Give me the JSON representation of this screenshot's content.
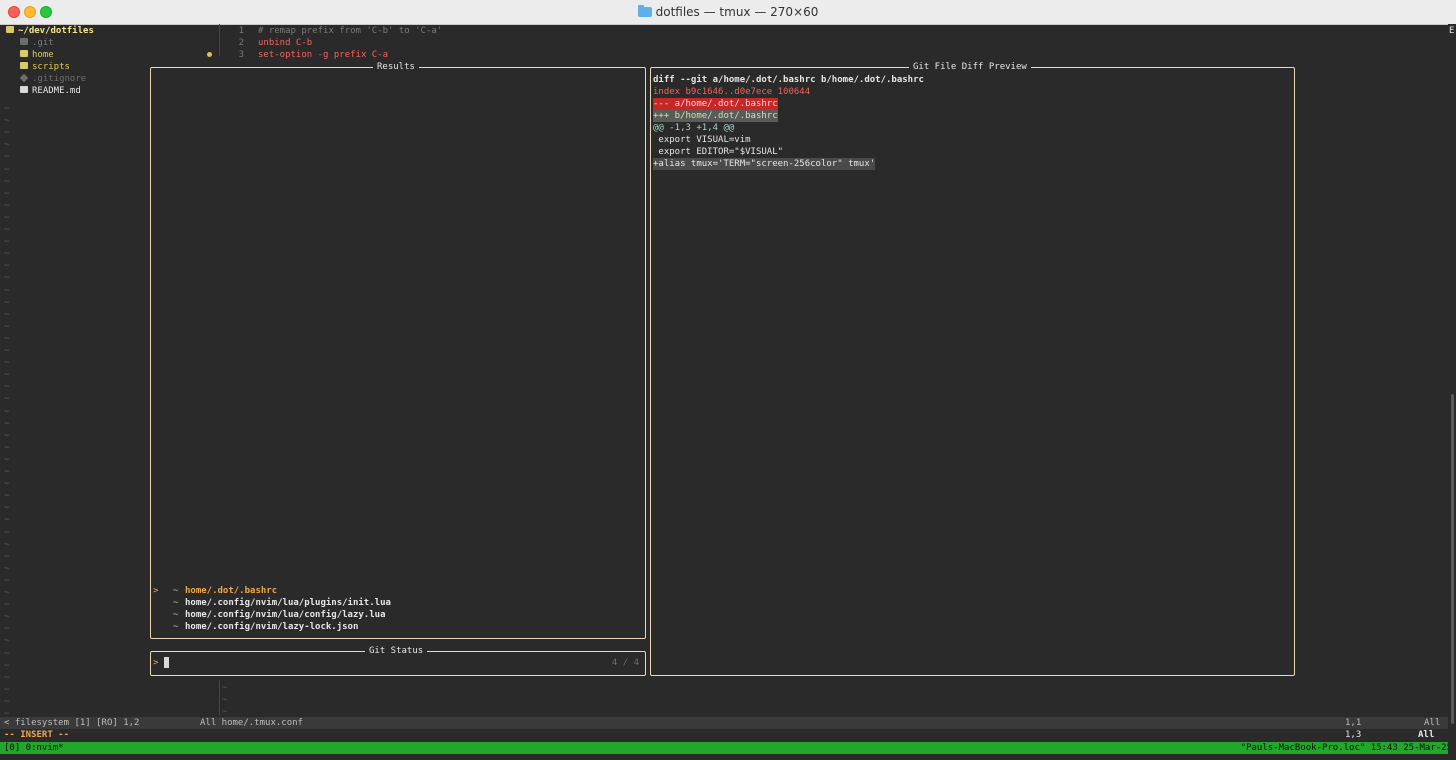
{
  "window": {
    "title": "dotfiles — tmux — 270×60"
  },
  "tree": {
    "root": "~/dev/dotfiles",
    "items": [
      {
        "name": ".git",
        "kind": "dir-dim",
        "color": "#7a7a7a"
      },
      {
        "name": "home",
        "kind": "dir",
        "color": "#d7c96c"
      },
      {
        "name": "scripts",
        "kind": "dir",
        "color": "#e3c94f"
      },
      {
        "name": ".gitignore",
        "kind": "file-dim",
        "color": "#6d6d6d"
      },
      {
        "name": "README.md",
        "kind": "md",
        "color": "#e6e6e6"
      }
    ]
  },
  "editor": {
    "lines": [
      {
        "n": "1",
        "text": "# remap prefix from 'C-b' to 'C-a'"
      },
      {
        "n": "2",
        "text": "unbind C-b"
      },
      {
        "n": "3",
        "text": "set-option -g prefix C-a"
      }
    ]
  },
  "results": {
    "title": "Results",
    "items": [
      {
        "path": "home/.dot/.bashrc",
        "status": "~",
        "selected": true
      },
      {
        "path": "home/.config/nvim/lua/plugins/init.lua",
        "status": "~",
        "selected": false
      },
      {
        "path": "home/.config/nvim/lua/config/lazy.lua",
        "status": "~",
        "selected": false
      },
      {
        "path": "home/.config/nvim/lazy-lock.json",
        "status": "~",
        "selected": false
      }
    ],
    "prompt_marker": ">"
  },
  "git_status": {
    "title": "Git Status",
    "prompt": ">",
    "count": "4 / 4"
  },
  "diff": {
    "title": "Git File Diff Preview",
    "lines": [
      {
        "text": "diff --git a/home/.dot/.bashrc b/home/.dot/.bashrc",
        "type": "header"
      },
      {
        "text": "index b9c1646..d0e7ece 100644",
        "type": "index"
      },
      {
        "text": "--- a/home/.dot/.bashrc",
        "type": "minus"
      },
      {
        "text": "+++ b/home/.dot/.bashrc",
        "type": "plus"
      },
      {
        "text": "@@ -1,3 +1,4 @@",
        "type": "hunk"
      },
      {
        "text": " export VISUAL=vim",
        "type": "ctx"
      },
      {
        "text": " export EDITOR=\"$VISUAL\"",
        "type": "ctx"
      },
      {
        "text": "+alias tmux='TERM=\"screen-256color\" tmux'",
        "type": "add"
      }
    ]
  },
  "statusline": {
    "left": "< filesystem [1] [RO] 1,2",
    "middle": "All home/.tmux.conf",
    "pos": "1,1",
    "scroll": "All"
  },
  "modeline": {
    "mode": "-- INSERT --",
    "pos": "1,3",
    "scroll": "All"
  },
  "tmux": {
    "window": "[0] 0:nvim*",
    "host": "\"Pauls-MacBook-Pro.loc\" 15:43 25-Mar-25"
  },
  "edge_glyph": "E",
  "colors": {
    "accent_green": "#21a82a",
    "border": "#e8d7b0",
    "selected": "#f0a84a",
    "keyword": "#f0655b",
    "string": "#b8d98a",
    "diff_minus_bg": "#c62828",
    "diff_plus_bg": "#5b5b5b"
  }
}
